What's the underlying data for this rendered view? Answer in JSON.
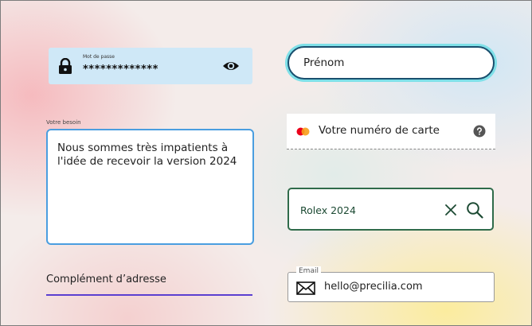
{
  "password": {
    "label": "Mot de passe",
    "masked_value": "*************"
  },
  "besoin": {
    "label": "Votre besoin",
    "value": "Nous sommes très impatients à l'idée de recevoir la version 2024"
  },
  "complement": {
    "placeholder": "Complément d’adresse"
  },
  "prenom": {
    "placeholder": "Prénom"
  },
  "carte": {
    "placeholder": "Votre numéro de carte"
  },
  "search": {
    "value": "Rolex 2024"
  },
  "email": {
    "label": "Email",
    "value": "hello@precilia.com"
  },
  "colors": {
    "focus_blue": "#4a9ee0",
    "underline_purple": "#5b3fd0",
    "search_green": "#2f6b4a",
    "glow_cyan": "#7fe0e8",
    "card_red": "#eb001b",
    "card_orange": "#f79e1b"
  }
}
